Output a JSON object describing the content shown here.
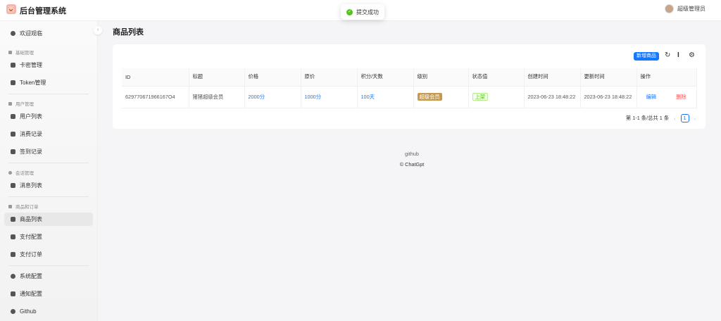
{
  "header": {
    "logo": "🐷",
    "brand": "后台管理系统",
    "user": "超级管理员"
  },
  "toast": {
    "text": "提交成功"
  },
  "sidebar": {
    "welcome": "欢迎观临",
    "groups": [
      "基础管理",
      "用户管理",
      "会话管理",
      "商品和订单"
    ],
    "items": {
      "card": "卡密管理",
      "token": "Token管理",
      "users": "用户列表",
      "consume": "消费记录",
      "signin": "签到记录",
      "messages": "消息列表",
      "products": "商品列表",
      "paycfg": "支付配置",
      "orders": "支付订单",
      "syscfg": "系统配置",
      "notify": "通知配置",
      "github": "Github"
    }
  },
  "page": {
    "title": "商品列表"
  },
  "toolbar": {
    "add": "新增商品"
  },
  "table": {
    "headers": [
      "ID",
      "标题",
      "价格",
      "原价",
      "积分/天数",
      "级别",
      "状态值",
      "创建时间",
      "更新时间",
      "操作"
    ],
    "row": {
      "id": "629770671966167O4",
      "title": "猪猪超级会员",
      "price": "2000分",
      "orig": "1000分",
      "points": "100天",
      "level": "超级会员",
      "status": "上架",
      "created": "2023-06-23 18:48:22",
      "updated": "2023-06-23 18:48:22",
      "edit": "编辑",
      "delete": "删除"
    }
  },
  "pagination": {
    "summary": "第 1-1 条/总共 1 条",
    "current": "1",
    "prev": "‹",
    "next": "›"
  },
  "footer": {
    "link": "github",
    "copyright": "© ChatGpt"
  }
}
